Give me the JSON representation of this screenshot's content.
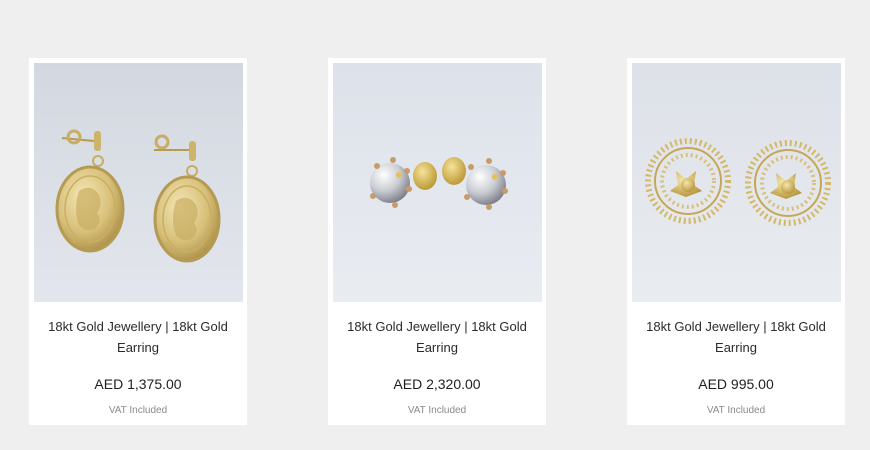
{
  "products": [
    {
      "image_icon": "coin-earrings-image",
      "title": "18kt Gold Jewellery | 18kt Gold Earring",
      "price": "AED 1,375.00",
      "vat": "VAT Included"
    },
    {
      "image_icon": "silver-ball-stud-earrings-image",
      "title": "18kt Gold Jewellery | 18kt Gold Earring",
      "price": "AED 2,320.00",
      "vat": "VAT Included"
    },
    {
      "image_icon": "sunburst-stud-earrings-image",
      "title": "18kt Gold Jewellery | 18kt Gold Earring",
      "price": "AED 995.00",
      "vat": "VAT Included"
    }
  ],
  "colors": {
    "page_background": "#efefef",
    "card_background": "#ffffff",
    "gold": "#d9c27a",
    "price_text": "#1f1f1f",
    "vat_text": "#8a8a8a"
  }
}
